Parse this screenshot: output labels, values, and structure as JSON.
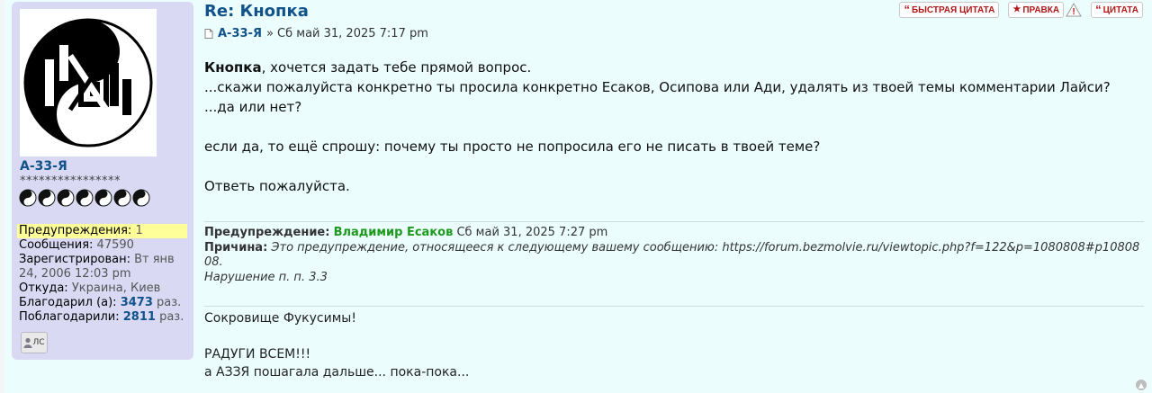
{
  "post": {
    "title": "Re: Кнопка",
    "author": "А-33-Я",
    "date": "» Сб май 31, 2025 7:17 pm",
    "buttons": {
      "quote": "БЫСТРАЯ ЦИТАТА",
      "edit": "ПРАВКА",
      "cite": "ЦИТАТА"
    },
    "body": {
      "addressee": "Кнопка",
      "line1_rest": ", хочется задать тебе прямой вопрос.",
      "line2": "...скажи пожалуйста конкретно ты просила конкретно Есаков, Осипова или Ади, удалять из твоей темы комментарии Лайси?",
      "line3": "...да или нет?",
      "line4": "если да, то ещё спрошу: почему ты просто не попросила его не писать в твоей теме?",
      "line5": "Ответь пожалуйста."
    },
    "warning": {
      "label": "Предупреждение:",
      "moderator": "Владимир Есаков",
      "date": "Сб май 31, 2025 7:27 pm",
      "reason_label": "Причина:",
      "reason_text": "Это предупреждение, относящееся к следующему вашему сообщению: https://forum.bezmolvie.ru/viewtopic.php?f=122&p=1080808#p1080808.",
      "violation": "Нарушение п. п. 3.3"
    },
    "signature": {
      "line1": "Сокровище Фукусимы!",
      "line2": "РАДУГИ ВСЕМ!!!",
      "line3": "а АЗЗЯ пошагала дальше... пока-пока..."
    }
  },
  "profile": {
    "username": "А-33-Я",
    "rank_stars": "****************",
    "rank_icon_count": 7,
    "warnings_label": "Предупреждения:",
    "warnings_value": "1",
    "messages_label": "Сообщения:",
    "messages_value": "47590",
    "registered_label": "Зарегистрирован:",
    "registered_value": "Вт янв 24, 2006 12:03 pm",
    "from_label": "Откуда:",
    "from_value": "Украина, Киев",
    "thanked_label": "Благодарил (а):",
    "thanked_value": "3473",
    "thanked_suffix": "раз.",
    "thanked_by_label": "Поблагодарили:",
    "thanked_by_value": "2811",
    "thanked_by_suffix": "раз.",
    "pm_label": "ЛС"
  },
  "colors": {
    "post_bg": "#ecfdfd",
    "profile_bg": "#d9d9f4",
    "link": "#105289",
    "moderator": "#1d9a1d",
    "warning_highlight": "#ffff99"
  }
}
